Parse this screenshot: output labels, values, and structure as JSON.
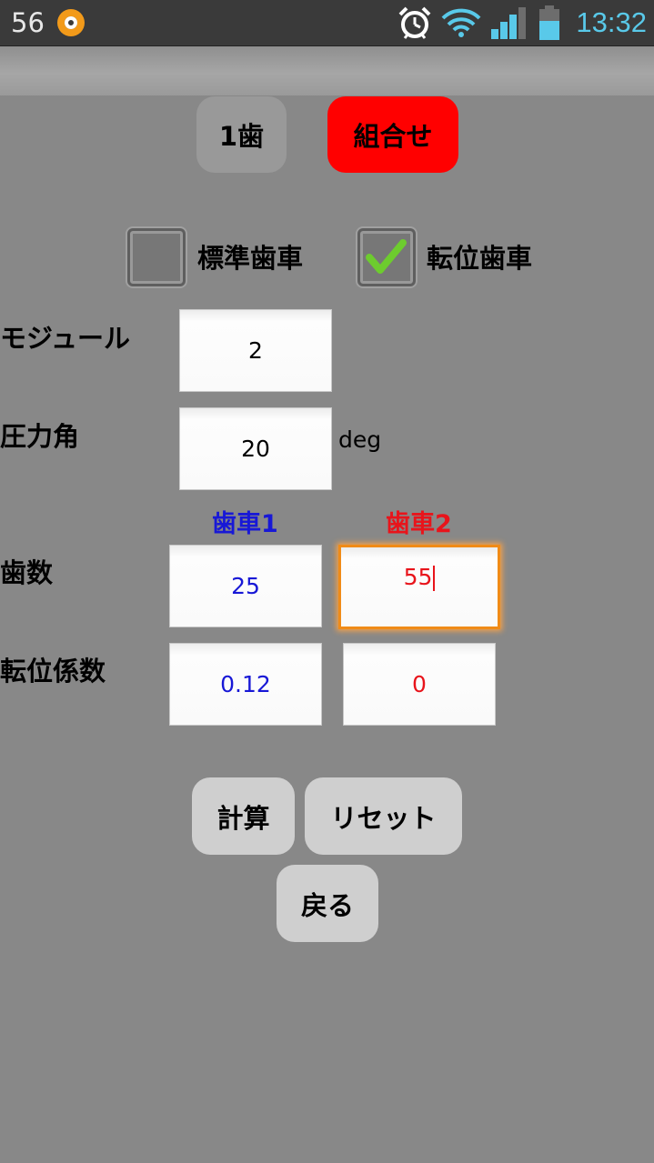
{
  "status_bar": {
    "notification_count": "56",
    "time": "13:32"
  },
  "tabs": {
    "single_label": "1歯",
    "combo_label": "組合せ"
  },
  "checkboxes": {
    "standard_label": "標準歯車",
    "standard_checked": false,
    "shifted_label": "転位歯車",
    "shifted_checked": true
  },
  "form": {
    "module_label": "モジュール",
    "module_value": "2",
    "pressure_angle_label": "圧力角",
    "pressure_angle_value": "20",
    "pressure_angle_unit": "deg",
    "gear1_header": "歯車1",
    "gear2_header": "歯車2",
    "teeth_label": "歯数",
    "gear1_teeth": "25",
    "gear2_teeth": "55",
    "shift_coef_label": "転位係数",
    "gear1_shift": "0.12",
    "gear2_shift": "0"
  },
  "buttons": {
    "calculate_label": "計算",
    "reset_label": "リセット",
    "back_label": "戻る"
  },
  "colors": {
    "gear1": "#1818d6",
    "gear2": "#e8141b",
    "combo_tab": "#ff0000",
    "focus": "#f08b17",
    "clock": "#59c9e9"
  },
  "icons": {
    "notification_app": "app-notification-icon",
    "alarm": "alarm-clock-icon",
    "wifi": "wifi-icon",
    "signal": "cell-signal-icon",
    "battery": "battery-icon",
    "check": "checkmark-icon"
  }
}
